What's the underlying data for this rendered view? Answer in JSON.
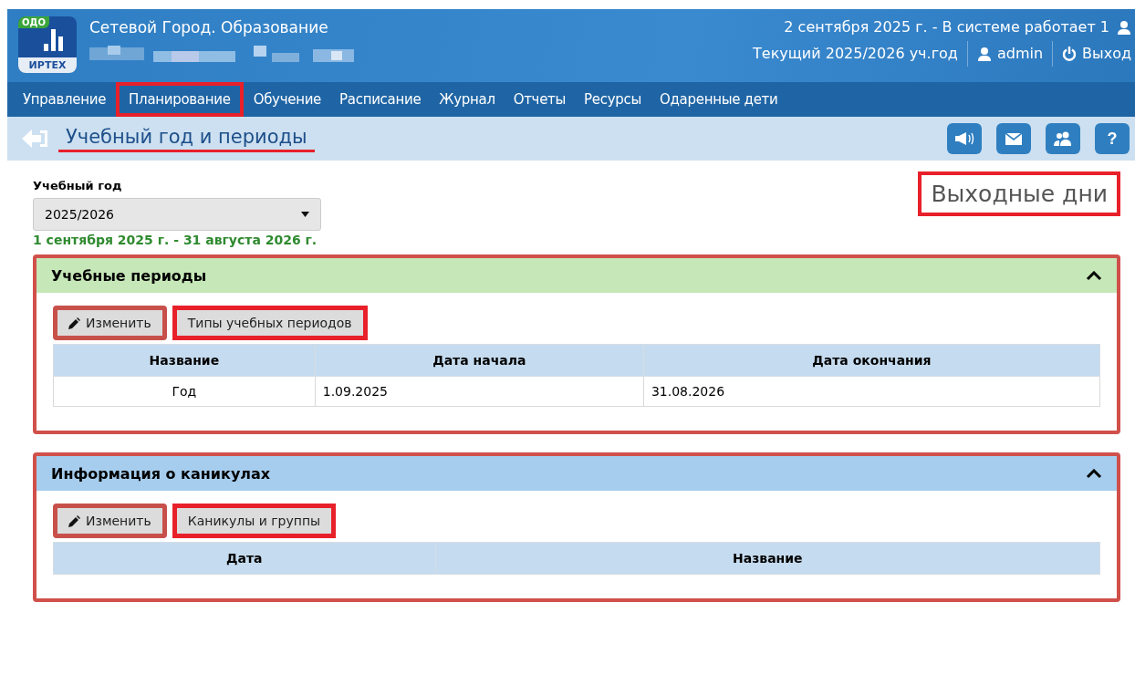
{
  "header": {
    "logo": {
      "badge": "ОДО",
      "caption": "ИРТЕХ"
    },
    "title": "Сетевой Город. Образование",
    "status": "2 сентября 2025 г. - В системе работает 1",
    "year": "Текущий 2025/2026 уч.год",
    "user": "admin",
    "logout": "Выход"
  },
  "nav": [
    {
      "label": "Управление",
      "highlighted": false
    },
    {
      "label": "Планирование",
      "highlighted": true
    },
    {
      "label": "Обучение",
      "highlighted": false
    },
    {
      "label": "Расписание",
      "highlighted": false
    },
    {
      "label": "Журнал",
      "highlighted": false
    },
    {
      "label": "Отчеты",
      "highlighted": false
    },
    {
      "label": "Ресурсы",
      "highlighted": false
    },
    {
      "label": "Одаренные дети",
      "highlighted": false
    }
  ],
  "page_title": {
    "text": "Учебный год и периоды",
    "highlighted": true
  },
  "toolbar": [
    {
      "kind": "megaphone"
    },
    {
      "kind": "mail"
    },
    {
      "kind": "users"
    },
    {
      "kind": "help",
      "label": "?"
    }
  ],
  "year_field": {
    "label": "Учебный год",
    "value": "2025/2026",
    "range": "1 сентября 2025 г. - 31 августа 2026 г."
  },
  "weekends_link": {
    "text": "Выходные дни",
    "highlighted": true
  },
  "sections": [
    {
      "title": "Учебные периоды",
      "color": "#c6e7b7",
      "highlighted": true,
      "expanded": true,
      "buttons": [
        {
          "label": "Изменить",
          "kind": "edit",
          "highlighted": true
        },
        {
          "label": "Типы учебных периодов",
          "kind": "plain",
          "highlighted": true
        }
      ],
      "columns": [
        "Название",
        "Дата начала",
        "Дата окончания"
      ],
      "rows": [
        [
          "Год",
          "1.09.2025",
          "31.08.2026"
        ]
      ]
    },
    {
      "title": "Информация о каникулах",
      "color": "#a6cdee",
      "highlighted": true,
      "expanded": true,
      "buttons": [
        {
          "label": "Изменить",
          "kind": "edit",
          "highlighted": true
        },
        {
          "label": "Каникулы и группы",
          "kind": "plain",
          "highlighted": true
        }
      ],
      "columns": [
        "Дата",
        "Название"
      ]
    }
  ]
}
